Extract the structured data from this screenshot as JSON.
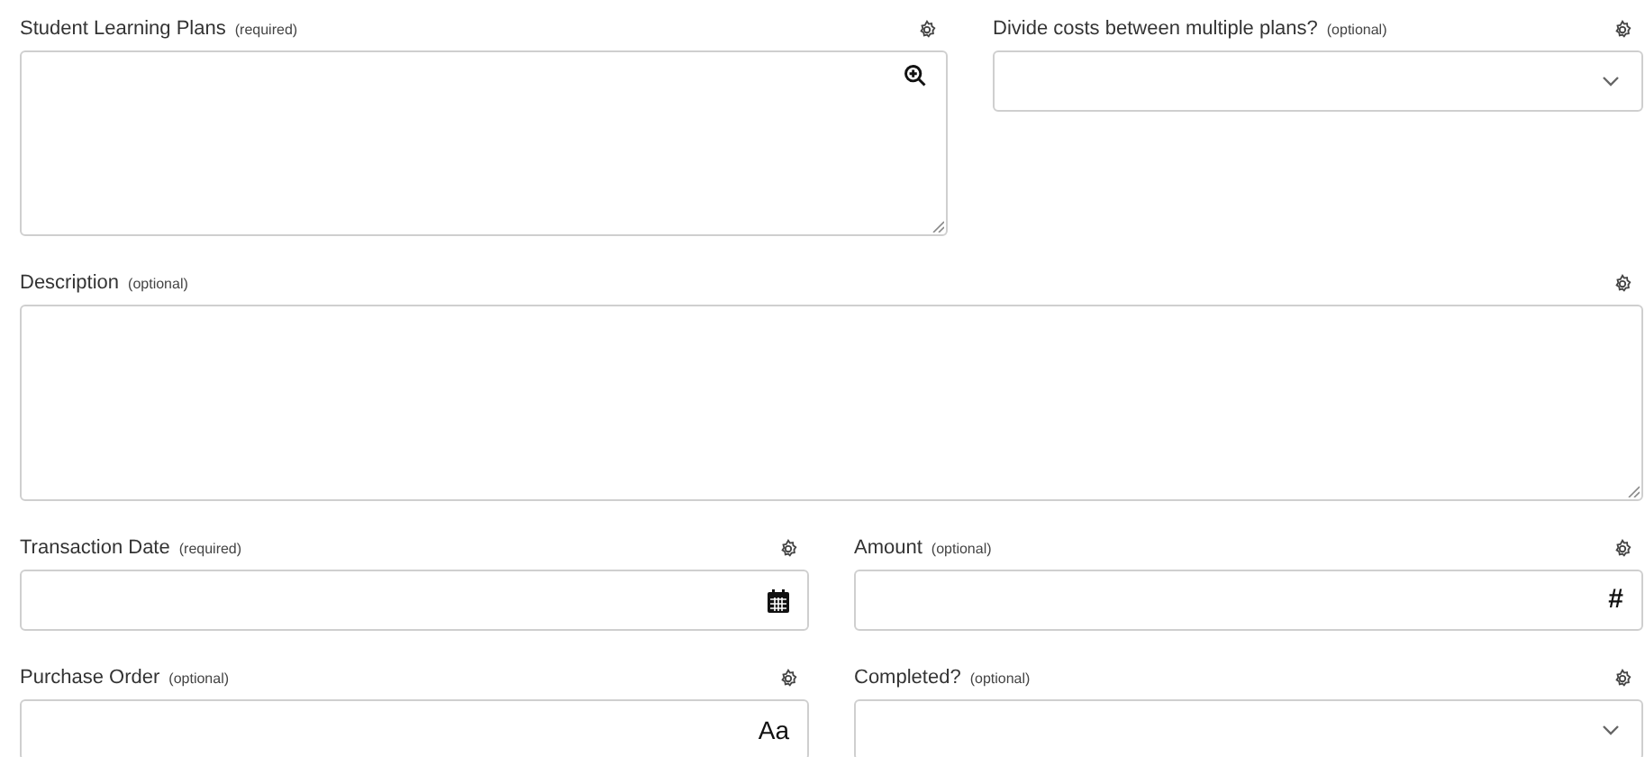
{
  "rows": [
    [
      {
        "label": "Student Learning Plans",
        "qualifier": "(required)",
        "kind": "lookup"
      },
      {
        "label": "Divide costs between multiple plans?",
        "qualifier": "(optional)",
        "kind": "select"
      }
    ],
    [
      {
        "label": "Description",
        "qualifier": "(optional)",
        "kind": "textarea"
      }
    ],
    [
      {
        "label": "Transaction Date",
        "qualifier": "(required)",
        "kind": "date"
      },
      {
        "label": "Amount",
        "qualifier": "(optional)",
        "kind": "number",
        "adornment": "#"
      }
    ],
    [
      {
        "label": "Purchase Order",
        "qualifier": "(optional)",
        "kind": "text",
        "adornment": "Aa"
      },
      {
        "label": "Completed?",
        "qualifier": "(optional)",
        "kind": "select"
      }
    ]
  ]
}
